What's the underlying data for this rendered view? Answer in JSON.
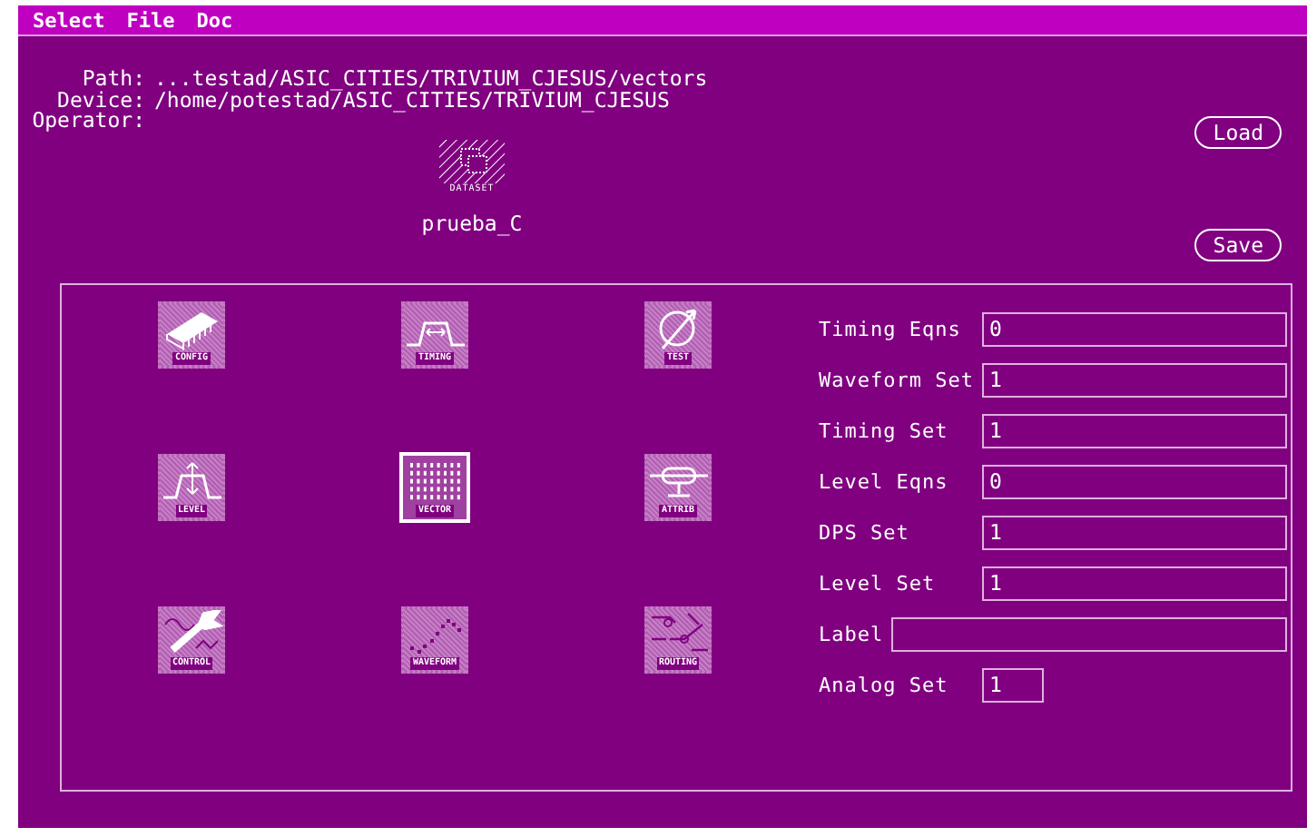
{
  "menu": [
    "Select",
    "File",
    "Doc"
  ],
  "info": [
    {
      "label": "Path:",
      "value": "...testad/ASIC_CITIES/TRIVIUM_CJESUS/vectors"
    },
    {
      "label": "Device:",
      "value": "/home/potestad/ASIC_CITIES/TRIVIUM_CJESUS"
    },
    {
      "label": "Operator:"
    }
  ],
  "dataset": {
    "badge": "DATASET",
    "name": "prueba_C"
  },
  "buttons": [
    "Load",
    "Save"
  ],
  "tools": [
    {
      "kind": "chip",
      "label": "CONFIG",
      "selected": false
    },
    {
      "kind": "pulse",
      "label": "TIMING",
      "selected": false
    },
    {
      "kind": "test",
      "label": "TEST",
      "selected": false
    },
    {
      "kind": "level",
      "label": "LEVEL",
      "selected": false
    },
    {
      "kind": "grid",
      "label": "VECTOR",
      "selected": true
    },
    {
      "kind": "attrib",
      "label": "ATTRIB",
      "selected": false
    },
    {
      "kind": "wrench",
      "label": "CONTROL",
      "selected": false
    },
    {
      "kind": "wave",
      "label": "WAVEFORM",
      "selected": false
    },
    {
      "kind": "circuit",
      "label": "ROUTING",
      "selected": false
    }
  ],
  "fields": [
    {
      "label": "Timing Eqns",
      "value": "0",
      "kind": "standard"
    },
    {
      "label": "Waveform Set",
      "value": "1",
      "kind": "standard"
    },
    {
      "label": "Timing Set",
      "value": "1",
      "kind": "standard"
    },
    {
      "label": "Level Eqns",
      "value": "0",
      "kind": "standard"
    },
    {
      "label": "DPS Set",
      "value": "1",
      "kind": "standard"
    },
    {
      "label": "Level Set",
      "value": "1",
      "kind": "standard"
    },
    {
      "label": "Label",
      "kind": "wide"
    },
    {
      "label": "Analog Set",
      "value": "1",
      "kind": "short"
    }
  ]
}
